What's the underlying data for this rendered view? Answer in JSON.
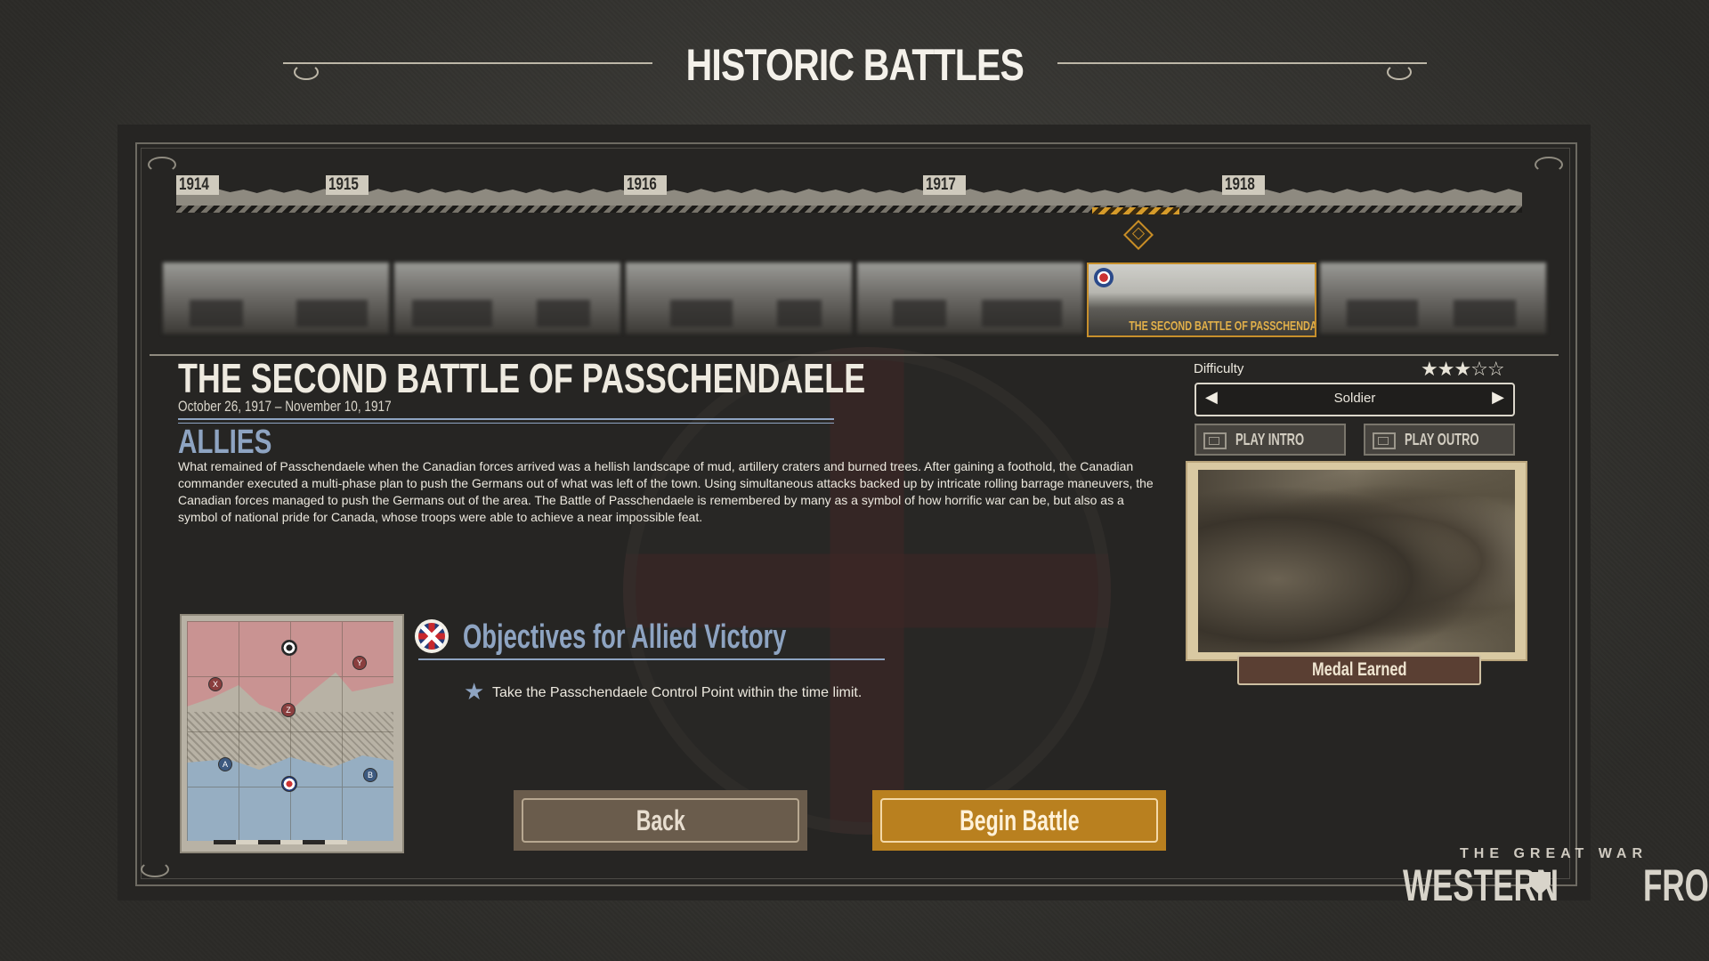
{
  "header": {
    "title": "HISTORIC BATTLES"
  },
  "timeline": {
    "years": [
      "1914",
      "1915",
      "1916",
      "1917",
      "1918"
    ]
  },
  "battles": {
    "selected_label": "THE SECOND BATTLE OF PASSCHENDAELE"
  },
  "battle": {
    "name": "THE SECOND BATTLE OF PASSCHENDAELE",
    "date": "October 26, 1917 – November 10, 1917",
    "faction": "ALLIES",
    "description": "What remained of Passchendaele when the Canadian forces arrived was a hellish landscape of mud, artillery craters and burned trees. After gaining a foothold, the Canadian commander executed a multi-phase plan to push the Germans out of what was left of the town. Using simultaneous attacks backed up by intricate rolling barrage maneuvers, the Canadian forces managed to push the Germans out of the area. The Battle of Passchendaele is remembered by many as a symbol of how horrific war can be, but also as a symbol of national pride for Canada, whose troops were able to achieve a near impossible feat."
  },
  "difficulty": {
    "label": "Difficulty",
    "value": "Soldier",
    "stars_filled": 3,
    "stars_total": 5,
    "stars_display": "★★★☆☆",
    "prev_arrow": "◀",
    "next_arrow": "▶"
  },
  "media": {
    "play_intro": "PLAY INTRO",
    "play_outro": "PLAY OUTRO",
    "medal_label": "Medal Earned"
  },
  "map": {
    "points": [
      "X",
      "Y",
      "Z",
      "A",
      "B"
    ]
  },
  "objectives": {
    "title": "Objectives for Allied Victory",
    "star_icon": "★",
    "items": [
      "Take the Passchendaele Control Point within the time limit."
    ]
  },
  "actions": {
    "back": "Back",
    "begin": "Begin Battle"
  },
  "logo": {
    "sub": "THE GREAT WAR",
    "main_left": "WESTERN",
    "main_right": "FRONT"
  },
  "colors": {
    "accent_blue": "#8ea4c2",
    "accent_gold": "#c78f2c",
    "begin_button": "#b9801f",
    "back_button": "#6a5c4c"
  }
}
